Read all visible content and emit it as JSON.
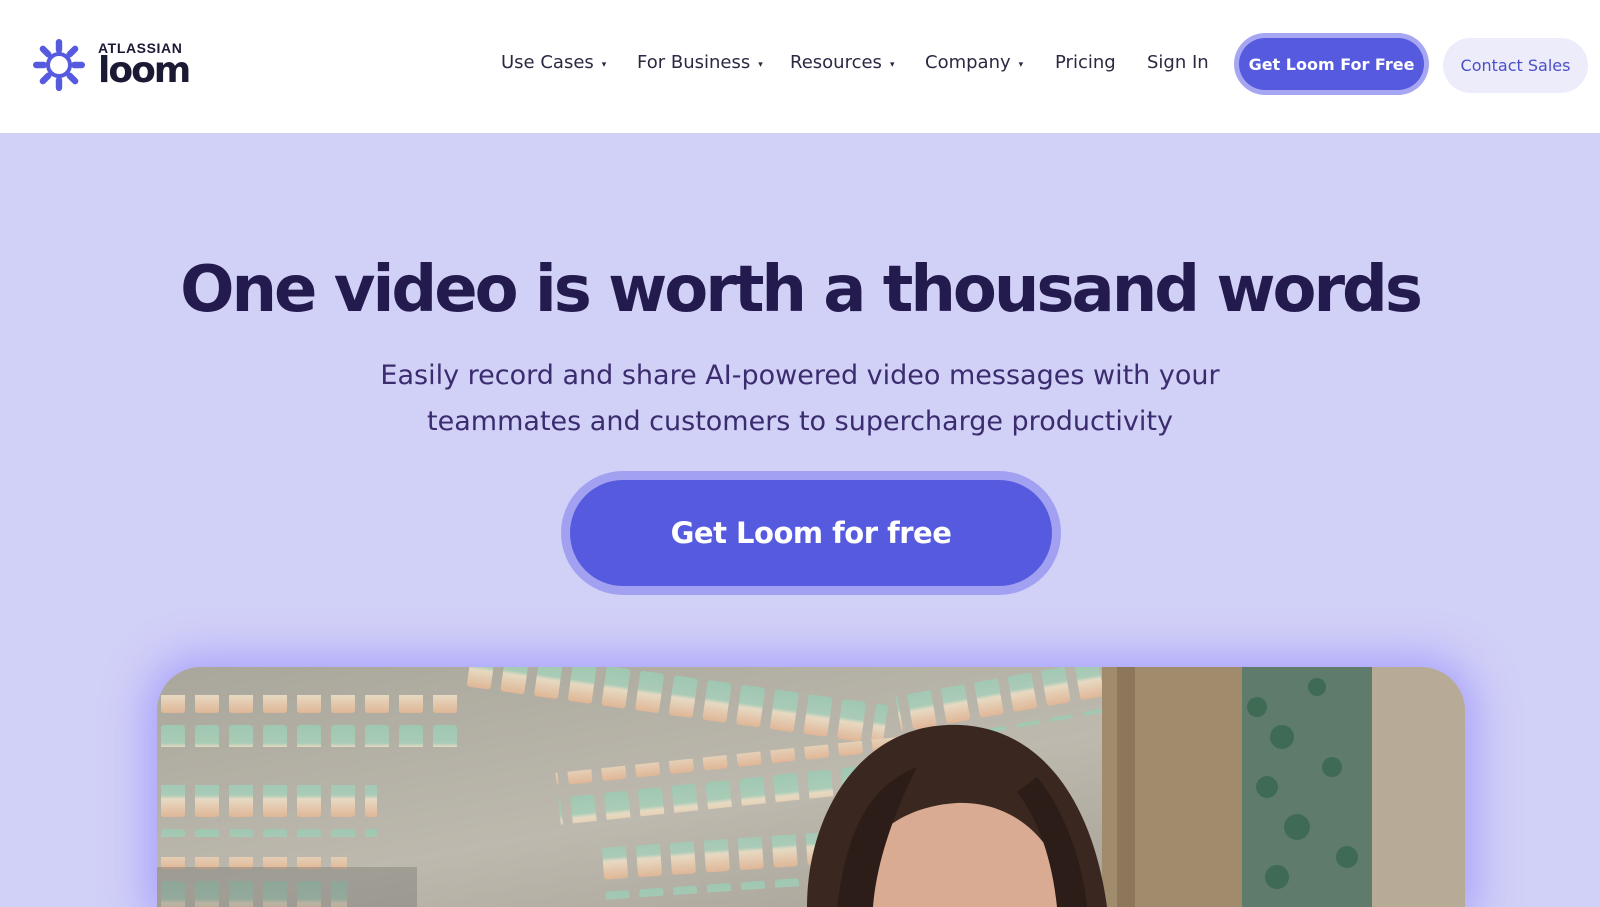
{
  "brand": {
    "company": "ATLASSIAN",
    "product": "loom",
    "logo_icon": "loom-starburst-icon",
    "accent": "#565adf"
  },
  "nav": {
    "items": [
      {
        "label": "Use Cases",
        "has_dropdown": true
      },
      {
        "label": "For Business",
        "has_dropdown": true
      },
      {
        "label": "Resources",
        "has_dropdown": true
      },
      {
        "label": "Company",
        "has_dropdown": true
      },
      {
        "label": "Pricing",
        "has_dropdown": false
      },
      {
        "label": "Sign In",
        "has_dropdown": false
      }
    ],
    "caret": "▾",
    "primary_button": "Get Loom For Free",
    "secondary_button": "Contact Sales"
  },
  "hero": {
    "title": "One video is worth a thousand words",
    "subtitle_line1": "Easily record and share AI-powered video messages with your",
    "subtitle_line2": "teammates and customers to supercharge productivity",
    "cta": "Get Loom for free",
    "background": "#d1d0f7"
  },
  "video": {
    "content": "woman-in-office-video-thumbnail"
  }
}
